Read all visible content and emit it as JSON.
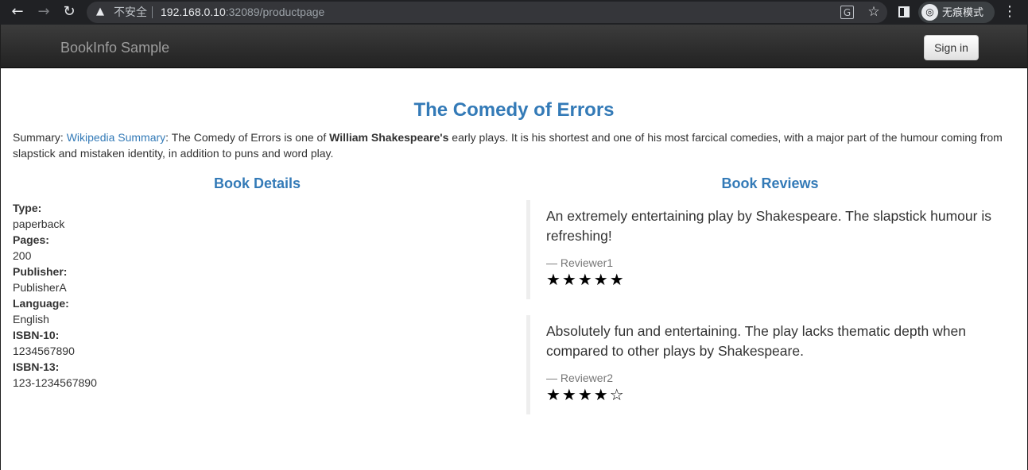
{
  "browser": {
    "back_icon": "←",
    "forward_icon": "→",
    "reload_icon": "↻",
    "warning_icon": "▲",
    "security_label": "不安全",
    "url_host": "192.168.0.10",
    "url_rest": ":32089/productpage",
    "translate_icon": "G",
    "bookmark_icon": "☆",
    "incognito_icon": "◎",
    "incognito_label": "无痕模式",
    "menu_icon": "⋮"
  },
  "navbar": {
    "brand": "BookInfo Sample",
    "signin_label": "Sign in"
  },
  "product": {
    "title": "The Comedy of Errors",
    "summary_prefix": "Summary: ",
    "summary_link": "Wikipedia Summary",
    "summary_mid": ": The Comedy of Errors is one of ",
    "summary_author": "William Shakespeare's",
    "summary_rest": " early plays. It is his shortest and one of his most farcical comedies, with a major part of the humour coming from slapstick and mistaken identity, in addition to puns and word play."
  },
  "details": {
    "heading": "Book Details",
    "fields": [
      {
        "label": "Type:",
        "value": "paperback"
      },
      {
        "label": "Pages:",
        "value": "200"
      },
      {
        "label": "Publisher:",
        "value": "PublisherA"
      },
      {
        "label": "Language:",
        "value": "English"
      },
      {
        "label": "ISBN-10:",
        "value": "1234567890"
      },
      {
        "label": "ISBN-13:",
        "value": "123-1234567890"
      }
    ]
  },
  "reviews": {
    "heading": "Book Reviews",
    "items": [
      {
        "text": "An extremely entertaining play by Shakespeare. The slapstick humour is refreshing!",
        "reviewer": "— Reviewer1",
        "stars": "★★★★★",
        "rating": 5
      },
      {
        "text": "Absolutely fun and entertaining. The play lacks thematic depth when compared to other plays by Shakespeare.",
        "reviewer": "— Reviewer2",
        "stars": "★★★★☆",
        "rating": 4
      }
    ]
  },
  "colors": {
    "link": "#337ab7",
    "navbar": "#222222",
    "chrome": "#202124"
  }
}
